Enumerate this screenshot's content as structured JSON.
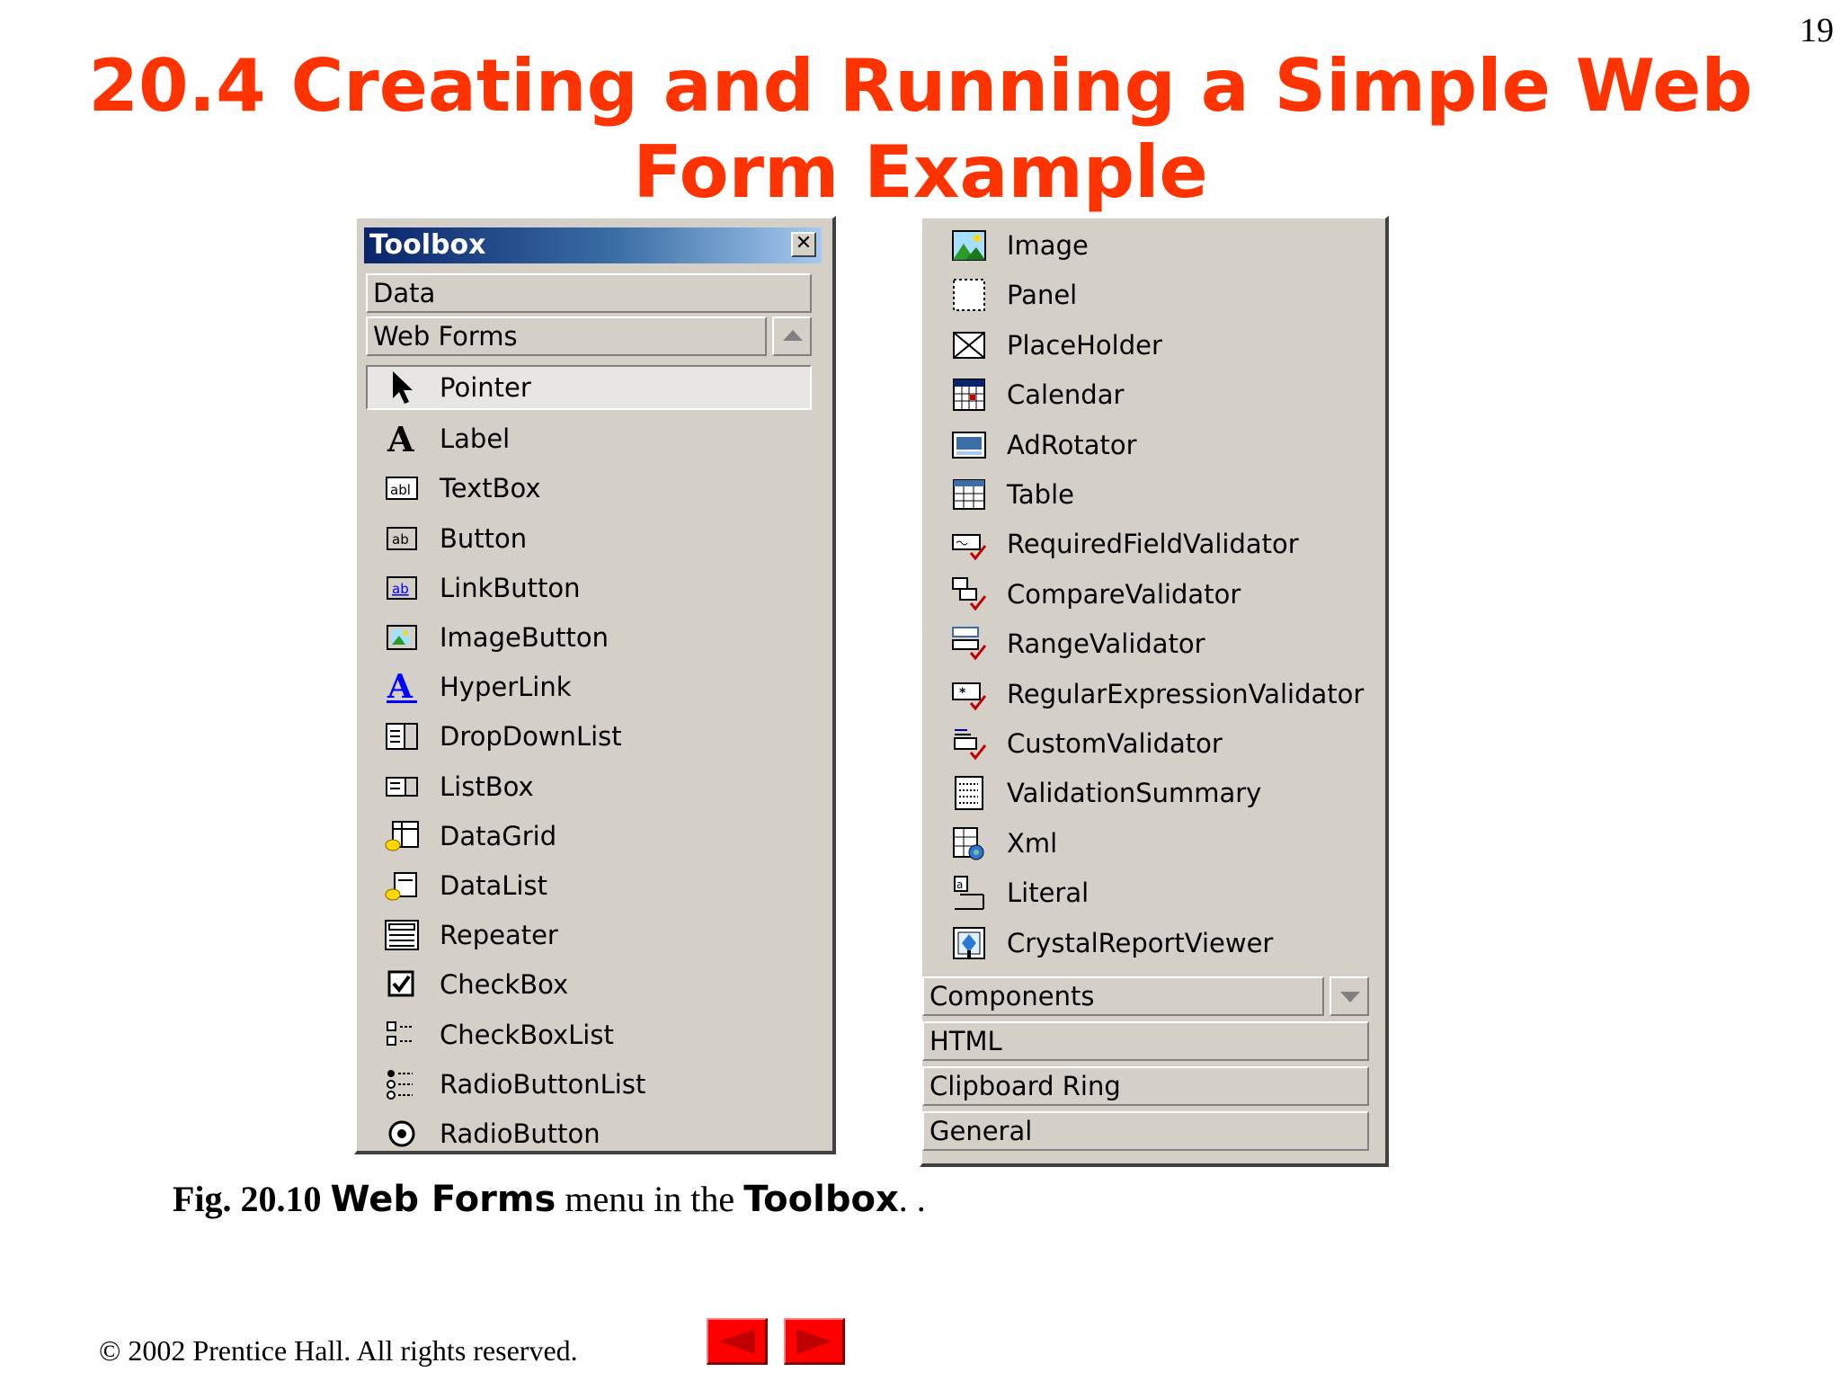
{
  "page_number": "19",
  "title": {
    "line1": "20.4  Creating and Running a Simple Web",
    "line2": "Form Example"
  },
  "toolbox": {
    "title": "Toolbox",
    "close_glyph": "✕",
    "tabs_top": [
      "Data",
      "Web Forms"
    ],
    "left_items": [
      {
        "label": "Pointer",
        "icon": "pointer-icon"
      },
      {
        "label": "Label",
        "icon": "label-icon"
      },
      {
        "label": "TextBox",
        "icon": "textbox-icon"
      },
      {
        "label": "Button",
        "icon": "button-icon"
      },
      {
        "label": "LinkButton",
        "icon": "linkbutton-icon"
      },
      {
        "label": "ImageButton",
        "icon": "imagebutton-icon"
      },
      {
        "label": "HyperLink",
        "icon": "hyperlink-icon"
      },
      {
        "label": "DropDownList",
        "icon": "dropdownlist-icon"
      },
      {
        "label": "ListBox",
        "icon": "listbox-icon"
      },
      {
        "label": "DataGrid",
        "icon": "datagrid-icon"
      },
      {
        "label": "DataList",
        "icon": "datalist-icon"
      },
      {
        "label": "Repeater",
        "icon": "repeater-icon"
      },
      {
        "label": "CheckBox",
        "icon": "checkbox-icon"
      },
      {
        "label": "CheckBoxList",
        "icon": "checkboxlist-icon"
      },
      {
        "label": "RadioButtonList",
        "icon": "radiobuttonlist-icon"
      },
      {
        "label": "RadioButton",
        "icon": "radiobutton-icon"
      }
    ],
    "right_items": [
      {
        "label": "Image",
        "icon": "image-icon"
      },
      {
        "label": "Panel",
        "icon": "panel-icon"
      },
      {
        "label": "PlaceHolder",
        "icon": "placeholder-icon"
      },
      {
        "label": "Calendar",
        "icon": "calendar-icon"
      },
      {
        "label": "AdRotator",
        "icon": "adrotator-icon"
      },
      {
        "label": "Table",
        "icon": "table-icon"
      },
      {
        "label": "RequiredFieldValidator",
        "icon": "requiredfieldvalidator-icon"
      },
      {
        "label": "CompareValidator",
        "icon": "comparevalidator-icon"
      },
      {
        "label": "RangeValidator",
        "icon": "rangevalidator-icon"
      },
      {
        "label": "RegularExpressionValidator",
        "icon": "regularexpressionvalidator-icon"
      },
      {
        "label": "CustomValidator",
        "icon": "customvalidator-icon"
      },
      {
        "label": "ValidationSummary",
        "icon": "validationsummary-icon"
      },
      {
        "label": "Xml",
        "icon": "xml-icon"
      },
      {
        "label": "Literal",
        "icon": "literal-icon"
      },
      {
        "label": "CrystalReportViewer",
        "icon": "crystalreportviewer-icon"
      }
    ],
    "tabs_bottom": [
      "Components",
      "HTML",
      "Clipboard Ring",
      "General"
    ]
  },
  "caption": {
    "fig": "Fig. 20.10",
    "code1": "Web Forms",
    "text1": " menu in the ",
    "code2": "Toolbox",
    "text2": ". ."
  },
  "footer": {
    "copyright": "© 2002 Prentice Hall.  All rights reserved."
  },
  "nav": {
    "prev_icon": "left-arrow-icon",
    "next_icon": "right-arrow-icon"
  }
}
